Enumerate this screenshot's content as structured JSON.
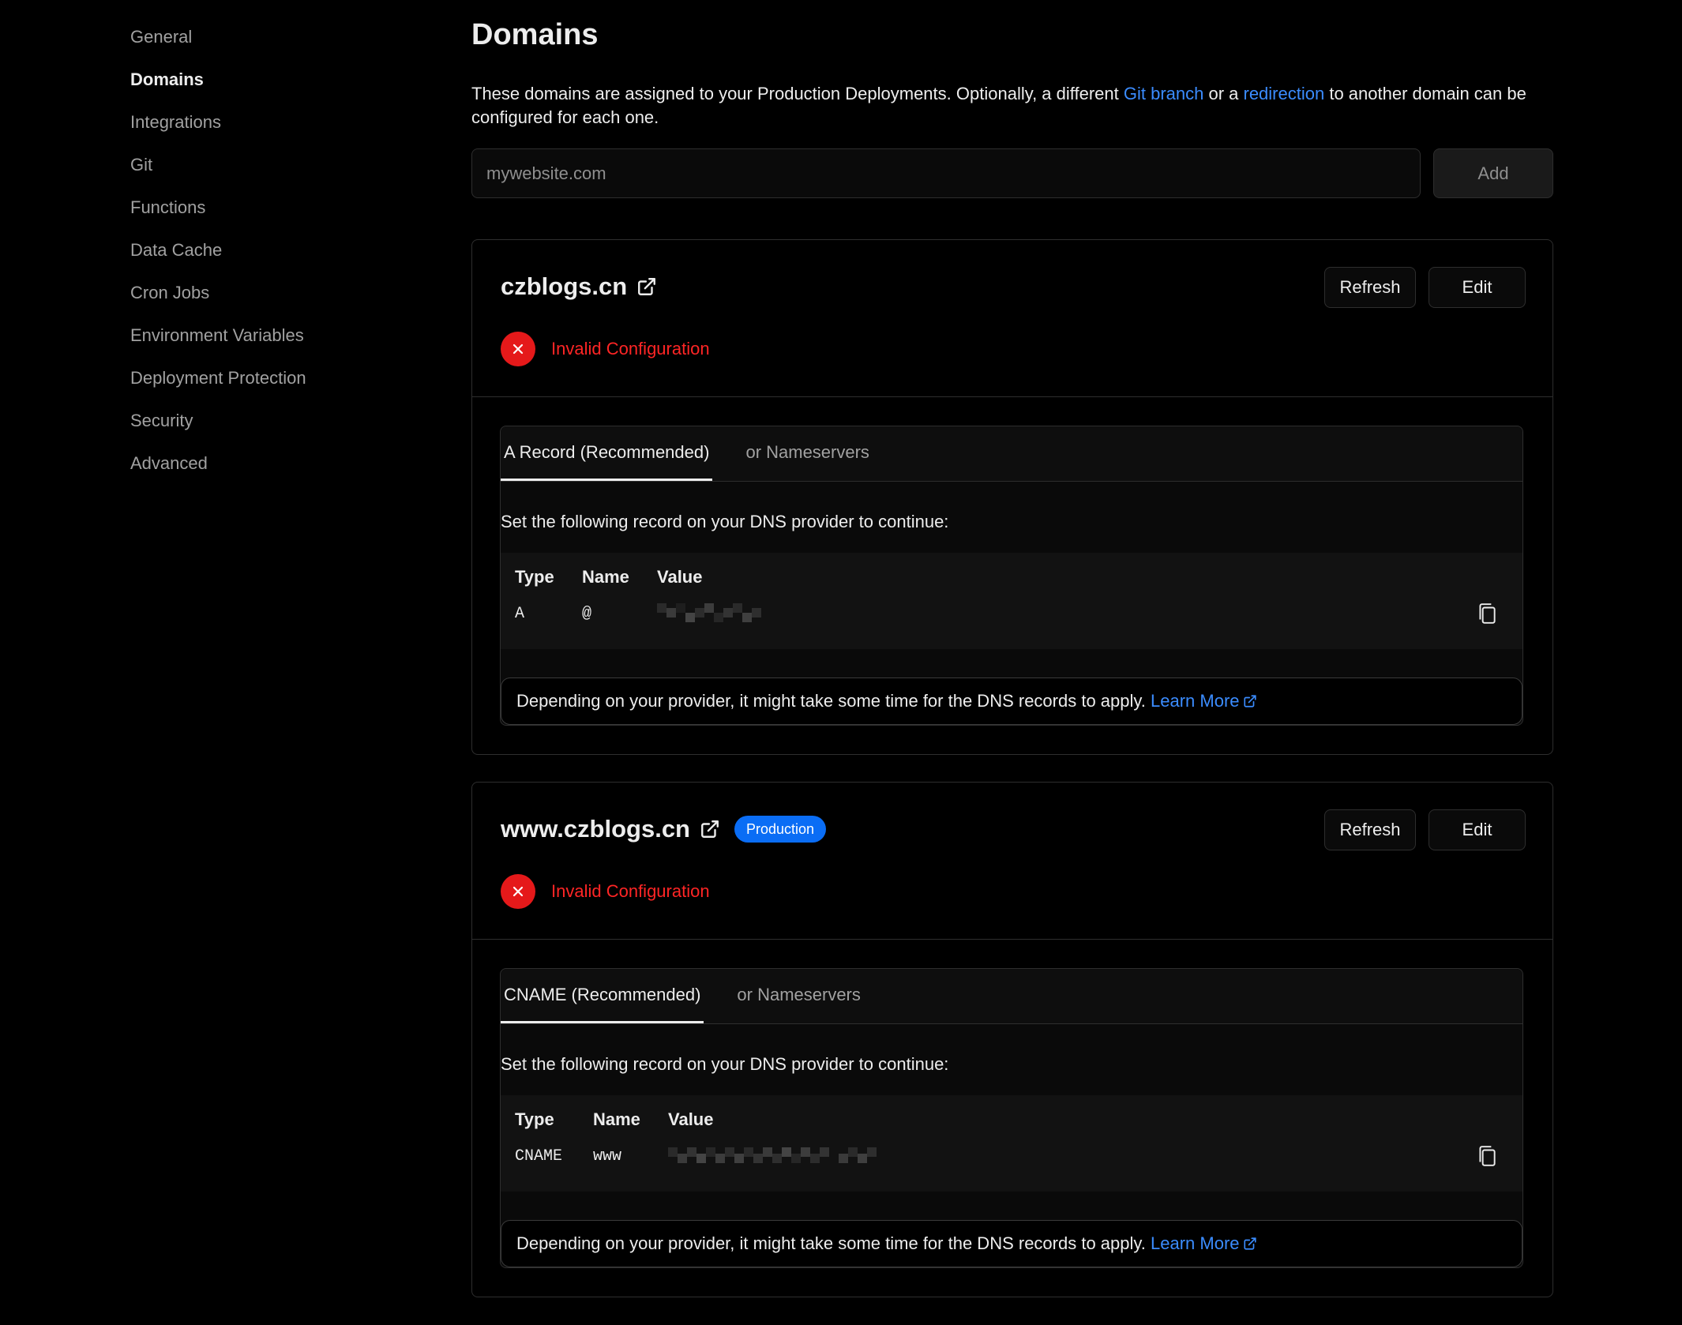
{
  "sidebar": {
    "items": [
      {
        "label": "General",
        "active": false
      },
      {
        "label": "Domains",
        "active": true
      },
      {
        "label": "Integrations",
        "active": false
      },
      {
        "label": "Git",
        "active": false
      },
      {
        "label": "Functions",
        "active": false
      },
      {
        "label": "Data Cache",
        "active": false
      },
      {
        "label": "Cron Jobs",
        "active": false
      },
      {
        "label": "Environment Variables",
        "active": false
      },
      {
        "label": "Deployment Protection",
        "active": false
      },
      {
        "label": "Security",
        "active": false
      },
      {
        "label": "Advanced",
        "active": false
      }
    ]
  },
  "header": {
    "title": "Domains",
    "intro_start": "These domains are assigned to your Production Deployments. Optionally, a different ",
    "intro_link1": "Git branch",
    "intro_mid": " or a ",
    "intro_link2": "redirection",
    "intro_end": " to another domain can be configured for each one."
  },
  "add_form": {
    "placeholder": "mywebsite.com",
    "button_label": "Add"
  },
  "domains": [
    {
      "name": "czblogs.cn",
      "badge": "",
      "refresh_label": "Refresh",
      "edit_label": "Edit",
      "status": "Invalid Configuration",
      "tabs": [
        "A Record (Recommended)",
        "or Nameservers"
      ],
      "instructions": "Set the following record on your DNS provider to continue:",
      "columns": [
        "Type",
        "Name",
        "Value"
      ],
      "record": {
        "type": "A",
        "name": "@",
        "value": "[redacted]"
      },
      "note": "Depending on your provider, it might take some time for the DNS records to apply.",
      "note_link": "Learn More"
    },
    {
      "name": "www.czblogs.cn",
      "badge": "Production",
      "refresh_label": "Refresh",
      "edit_label": "Edit",
      "status": "Invalid Configuration",
      "tabs": [
        "CNAME (Recommended)",
        "or Nameservers"
      ],
      "instructions": "Set the following record on your DNS provider to continue:",
      "columns": [
        "Type",
        "Name",
        "Value"
      ],
      "record": {
        "type": "CNAME",
        "name": "www",
        "value": "[redacted]"
      },
      "note": "Depending on your provider, it might take some time for the DNS records to apply.",
      "note_link": "Learn More"
    }
  ],
  "colors": {
    "background": "#000000",
    "link": "#3b8cff",
    "error": "#e5191a",
    "badge": "#0a6df5"
  },
  "icons": [
    "external-link-icon",
    "error-x-icon",
    "copy-icon"
  ]
}
